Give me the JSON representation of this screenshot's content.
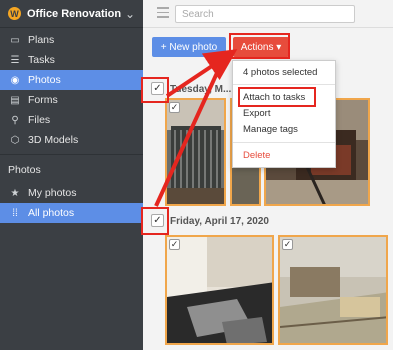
{
  "sidebar": {
    "project_logo": "W",
    "project_name": "Office Renovation",
    "chevron": "⌄",
    "items": [
      {
        "label": "Plans",
        "icon": "map-icon",
        "glyph": "▭"
      },
      {
        "label": "Tasks",
        "icon": "list-icon",
        "glyph": "☰"
      },
      {
        "label": "Photos",
        "icon": "camera-icon",
        "glyph": "◉"
      },
      {
        "label": "Forms",
        "icon": "clipboard-icon",
        "glyph": "▤"
      },
      {
        "label": "Files",
        "icon": "paperclip-icon",
        "glyph": "⚲"
      },
      {
        "label": "3D Models",
        "icon": "cube-icon",
        "glyph": "⬡"
      }
    ],
    "section_title": "Photos",
    "sub_items": [
      {
        "label": "My photos",
        "icon": "star-icon",
        "glyph": "★"
      },
      {
        "label": "All photos",
        "icon": "grid-icon",
        "glyph": "⁞⁞"
      }
    ]
  },
  "topbar": {
    "search_placeholder": "Search"
  },
  "toolbar": {
    "new_photo_label": "+ New photo",
    "actions_label": "Actions ▾"
  },
  "groups": [
    {
      "date": "Tuesday, M..."
    },
    {
      "date": "Friday, April 17, 2020"
    }
  ],
  "check_glyph": "✓",
  "actions_menu": {
    "selected_count_label": "4 photos selected",
    "attach_label": "Attach to tasks",
    "export_label": "Export",
    "manage_tags_label": "Manage tags",
    "delete_label": "Delete"
  },
  "colors": {
    "accent_blue": "#5d8ee6",
    "action_red": "#e74c3c",
    "annotation_red": "#e5261f",
    "selection_orange": "#f0a64b"
  }
}
